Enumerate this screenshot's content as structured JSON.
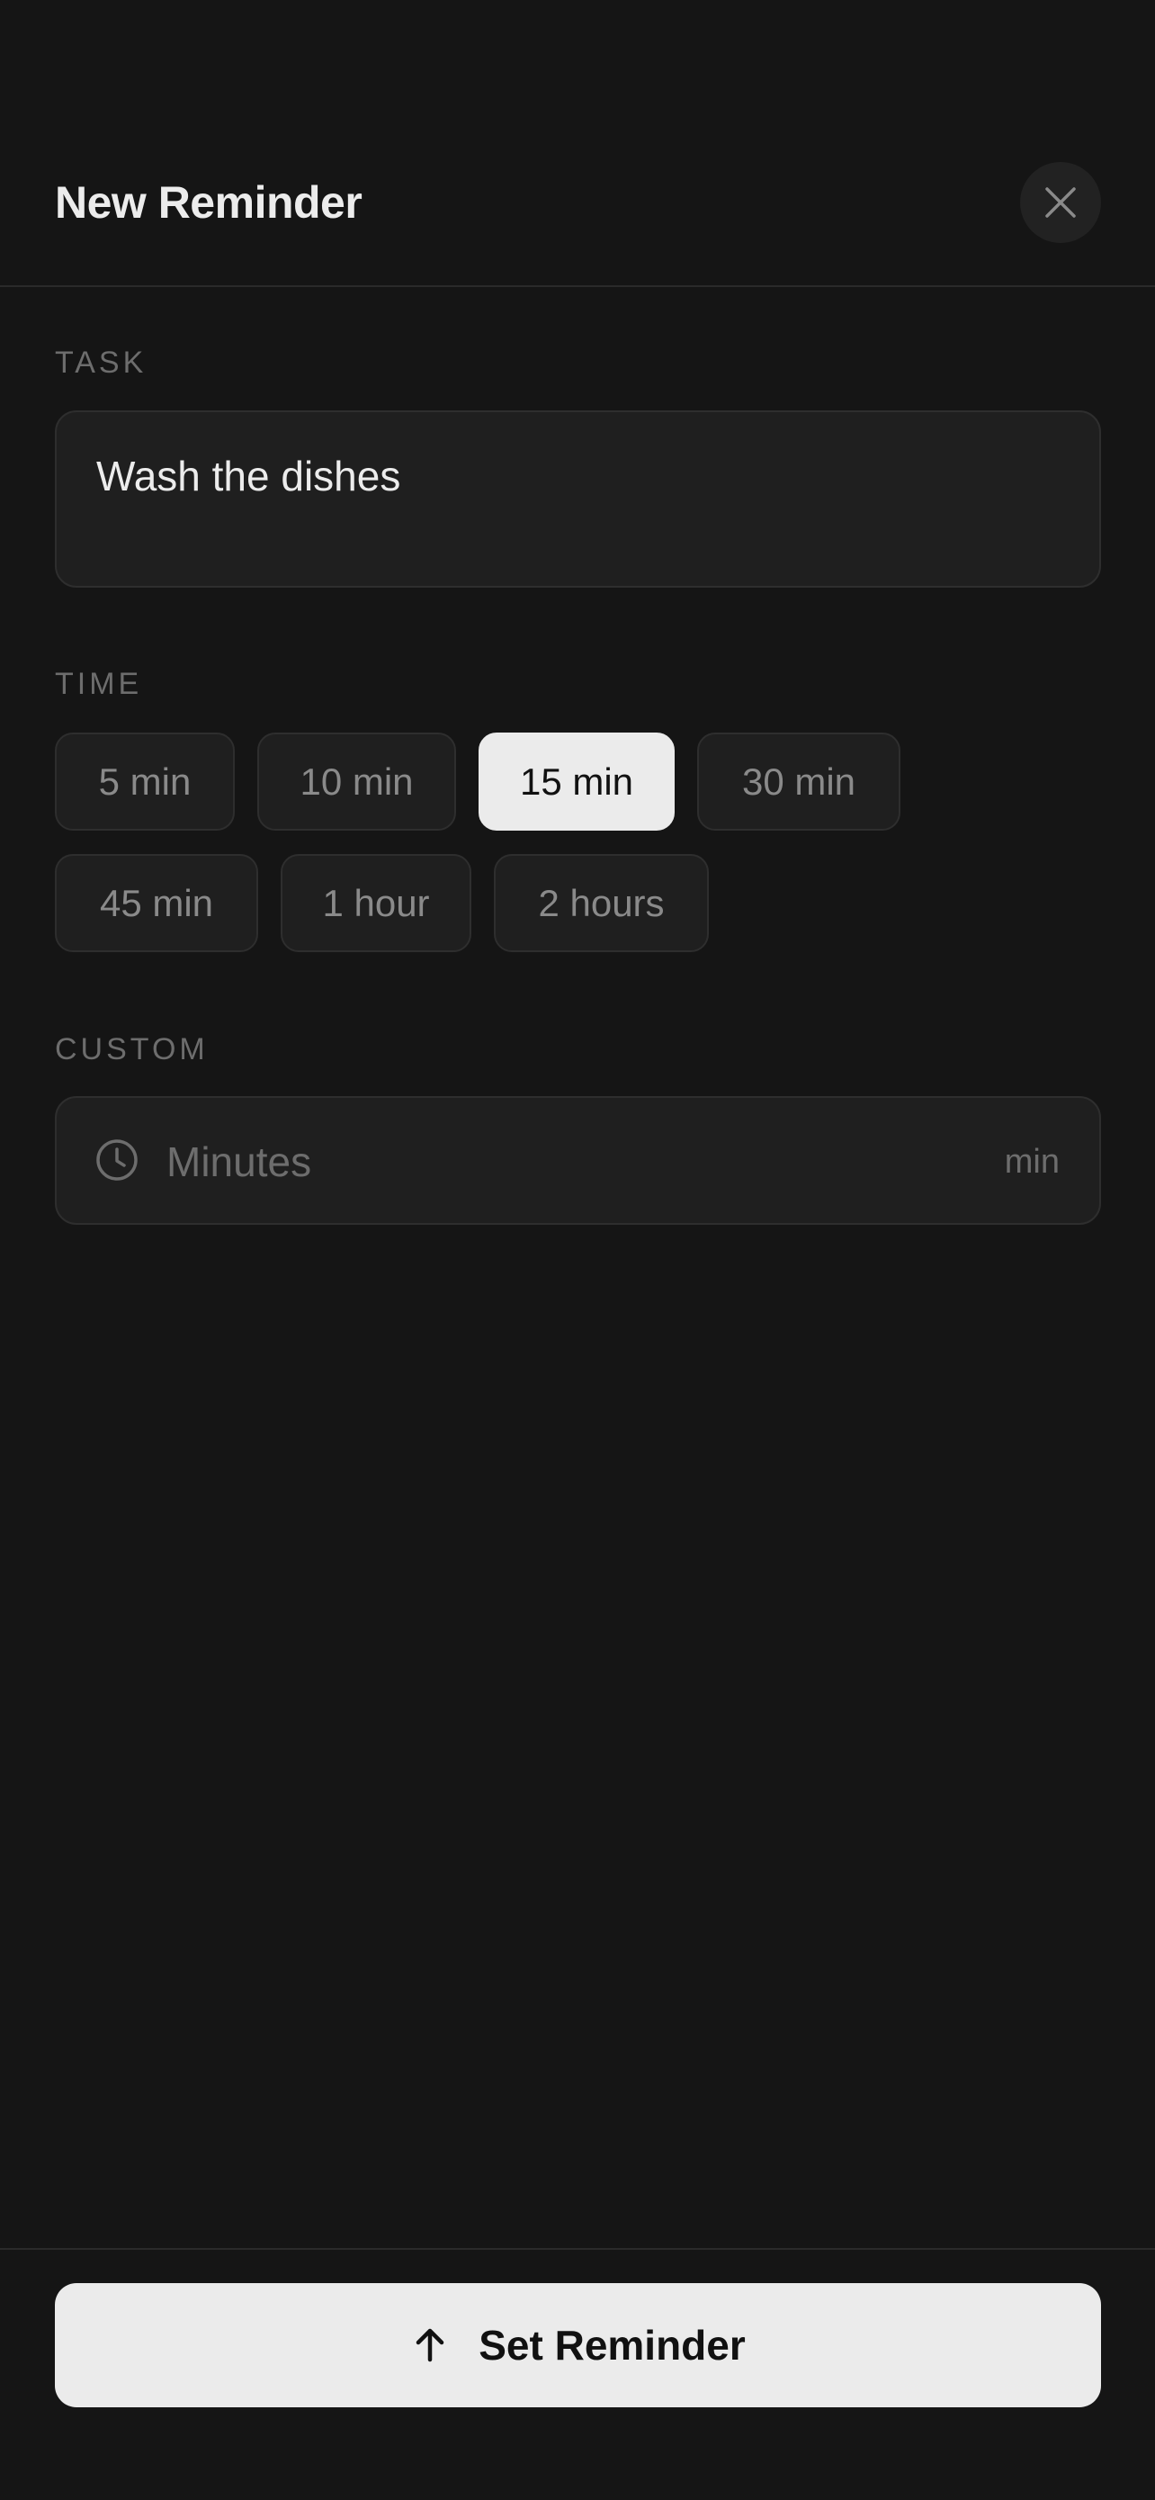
{
  "header": {
    "title": "New Reminder",
    "close_icon": "close-icon"
  },
  "task": {
    "label": "TASK",
    "value": "Wash the dishes"
  },
  "time": {
    "label": "TIME",
    "options": [
      "5 min",
      "10 min",
      "15 min",
      "30 min",
      "45 min",
      "1 hour",
      "2 hours"
    ],
    "selected": "15 min"
  },
  "custom": {
    "label": "CUSTOM",
    "placeholder": "Minutes",
    "unit": "min",
    "icon": "clock-icon"
  },
  "footer": {
    "button_label": "Set Reminder",
    "button_icon": "arrow-up-icon"
  },
  "colors": {
    "background": "#151515",
    "surface": "#1f1f1f",
    "accent": "#ebebeb"
  }
}
